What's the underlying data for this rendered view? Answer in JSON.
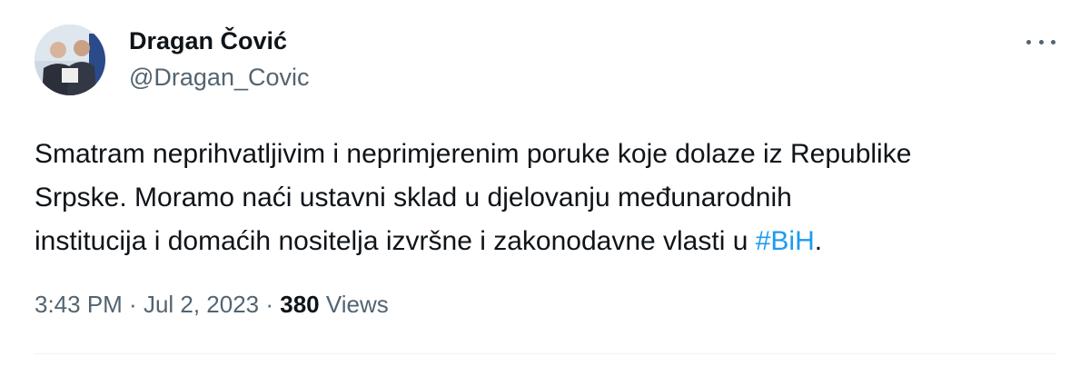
{
  "author": {
    "display_name": "Dragan Čović",
    "handle": "@Dragan_Covic",
    "avatar_icon": "profile-photo"
  },
  "more_icon": "more-horizontal-icon",
  "tweet": {
    "text_before": "Smatram neprihvatljivim i neprimjerenim poruke koje dolaze iz Republike\nSrpske. Moramo naći ustavni sklad u djelovanju međunarodnih\ninstitucija i domaćih nositelja izvršne i zakonodavne vlasti u ",
    "hashtag": "#BiH",
    "text_after": "."
  },
  "meta": {
    "time": "3:43 PM",
    "separator": " · ",
    "date": "Jul 2, 2023",
    "views_count": "380",
    "views_label": " Views"
  },
  "colors": {
    "link": "#1d9bf0",
    "secondary_text": "#536471",
    "primary_text": "#0f1419"
  }
}
